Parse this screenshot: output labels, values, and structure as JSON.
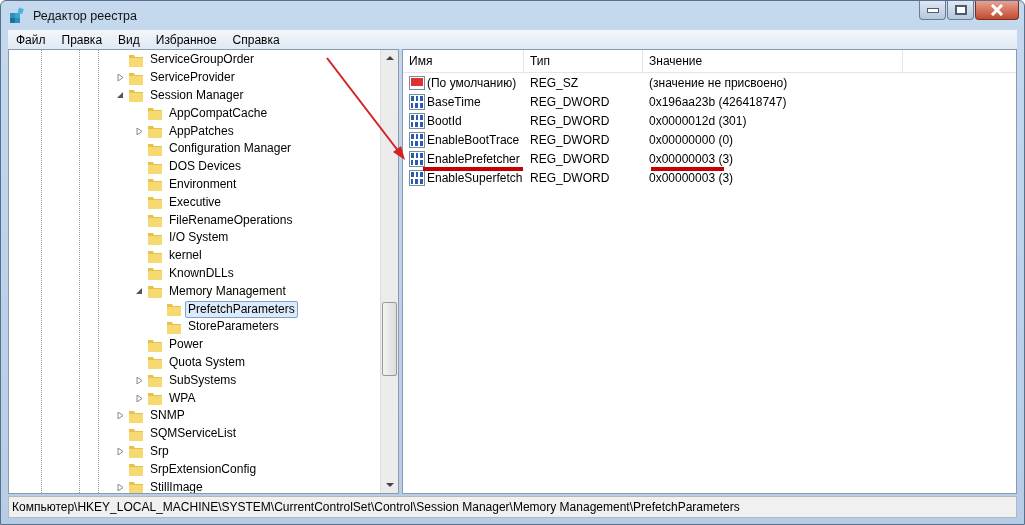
{
  "window": {
    "title": "Редактор реестра"
  },
  "menu": [
    "Файл",
    "Правка",
    "Вид",
    "Избранное",
    "Справка"
  ],
  "tree": [
    {
      "name": "ServiceGroupOrder",
      "expandable": false,
      "selected": false
    },
    {
      "name": "ServiceProvider",
      "expandable": true,
      "expanded": false,
      "selected": false
    },
    {
      "name": "Session Manager",
      "expandable": true,
      "expanded": true,
      "selected": false,
      "children": [
        {
          "name": "AppCompatCache",
          "expandable": false,
          "selected": false
        },
        {
          "name": "AppPatches",
          "expandable": true,
          "expanded": false,
          "selected": false
        },
        {
          "name": "Configuration Manager",
          "expandable": false,
          "selected": false
        },
        {
          "name": "DOS Devices",
          "expandable": false,
          "selected": false
        },
        {
          "name": "Environment",
          "expandable": false,
          "selected": false
        },
        {
          "name": "Executive",
          "expandable": false,
          "selected": false
        },
        {
          "name": "FileRenameOperations",
          "expandable": false,
          "selected": false
        },
        {
          "name": "I/O System",
          "expandable": false,
          "selected": false
        },
        {
          "name": "kernel",
          "expandable": false,
          "selected": false
        },
        {
          "name": "KnownDLLs",
          "expandable": false,
          "selected": false
        },
        {
          "name": "Memory Management",
          "expandable": true,
          "expanded": true,
          "selected": false,
          "children": [
            {
              "name": "PrefetchParameters",
              "expandable": false,
              "selected": true
            },
            {
              "name": "StoreParameters",
              "expandable": false,
              "selected": false
            }
          ]
        },
        {
          "name": "Power",
          "expandable": false,
          "selected": false
        },
        {
          "name": "Quota System",
          "expandable": false,
          "selected": false
        },
        {
          "name": "SubSystems",
          "expandable": true,
          "expanded": false,
          "selected": false
        },
        {
          "name": "WPA",
          "expandable": true,
          "expanded": false,
          "selected": false
        }
      ]
    },
    {
      "name": "SNMP",
      "expandable": true,
      "expanded": false,
      "selected": false
    },
    {
      "name": "SQMServiceList",
      "expandable": false,
      "selected": false
    },
    {
      "name": "Srp",
      "expandable": true,
      "expanded": false,
      "selected": false
    },
    {
      "name": "SrpExtensionConfig",
      "expandable": false,
      "selected": false
    },
    {
      "name": "StillImage",
      "expandable": true,
      "expanded": false,
      "selected": false
    }
  ],
  "table": {
    "columns": [
      "Имя",
      "Тип",
      "Значение"
    ],
    "rows": [
      {
        "kind": "string",
        "name": "(По умолчанию)",
        "type": "REG_SZ",
        "value": "(значение не присвоено)"
      },
      {
        "kind": "binary",
        "name": "BaseTime",
        "type": "REG_DWORD",
        "value": "0x196aa23b (426418747)"
      },
      {
        "kind": "binary",
        "name": "BootId",
        "type": "REG_DWORD",
        "value": "0x0000012d (301)"
      },
      {
        "kind": "binary",
        "name": "EnableBootTrace",
        "type": "REG_DWORD",
        "value": "0x00000000 (0)"
      },
      {
        "kind": "binary",
        "name": "EnablePrefetcher",
        "type": "REG_DWORD",
        "value": "0x00000003 (3)"
      },
      {
        "kind": "binary",
        "name": "EnableSuperfetch",
        "type": "REG_DWORD",
        "value": "0x00000003 (3)"
      }
    ]
  },
  "status_bar": "Компьютер\\HKEY_LOCAL_MACHINE\\SYSTEM\\CurrentControlSet\\Control\\Session Manager\\Memory Management\\PrefetchParameters"
}
